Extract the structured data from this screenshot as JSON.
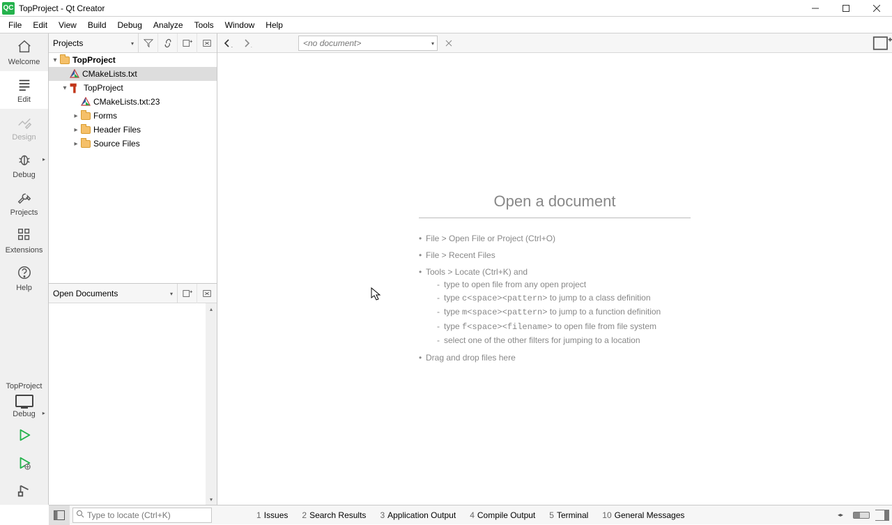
{
  "window": {
    "title": "TopProject - Qt Creator"
  },
  "menu": {
    "items": [
      "File",
      "Edit",
      "View",
      "Build",
      "Debug",
      "Analyze",
      "Tools",
      "Window",
      "Help"
    ]
  },
  "modes": {
    "welcome": "Welcome",
    "edit": "Edit",
    "design": "Design",
    "debug": "Debug",
    "projects": "Projects",
    "extensions": "Extensions",
    "help": "Help"
  },
  "kit": {
    "project": "TopProject",
    "config": "Debug"
  },
  "sidebar": {
    "projects_combo": "Projects",
    "tree": {
      "root": "TopProject",
      "cmake": "CMakeLists.txt",
      "sub": "TopProject",
      "cmake_err": "CMakeLists.txt:23",
      "forms": "Forms",
      "headers": "Header Files",
      "sources": "Source Files"
    },
    "open_docs_combo": "Open Documents"
  },
  "editor": {
    "doc_combo": "<no document>",
    "placeholder": {
      "title": "Open a document",
      "l1": "File > Open File or Project (Ctrl+O)",
      "l2": "File > Recent Files",
      "l3": "Tools > Locate (Ctrl+K) and",
      "s1a": "type to open file from any open project",
      "s2a": "type ",
      "s2c": "c<space><pattern>",
      "s2b": " to jump to a class definition",
      "s3a": "type ",
      "s3c": "m<space><pattern>",
      "s3b": " to jump to a function definition",
      "s4a": "type ",
      "s4c": "f<space><filename>",
      "s4b": " to open file from file system",
      "s5": "select one of the other filters for jumping to a location",
      "l4": "Drag and drop files here"
    }
  },
  "status": {
    "locator_placeholder": "Type to locate (Ctrl+K)",
    "panes": [
      {
        "n": "1",
        "t": "Issues"
      },
      {
        "n": "2",
        "t": "Search Results"
      },
      {
        "n": "3",
        "t": "Application Output"
      },
      {
        "n": "4",
        "t": "Compile Output"
      },
      {
        "n": "5",
        "t": "Terminal"
      },
      {
        "n": "10",
        "t": "General Messages"
      }
    ]
  }
}
